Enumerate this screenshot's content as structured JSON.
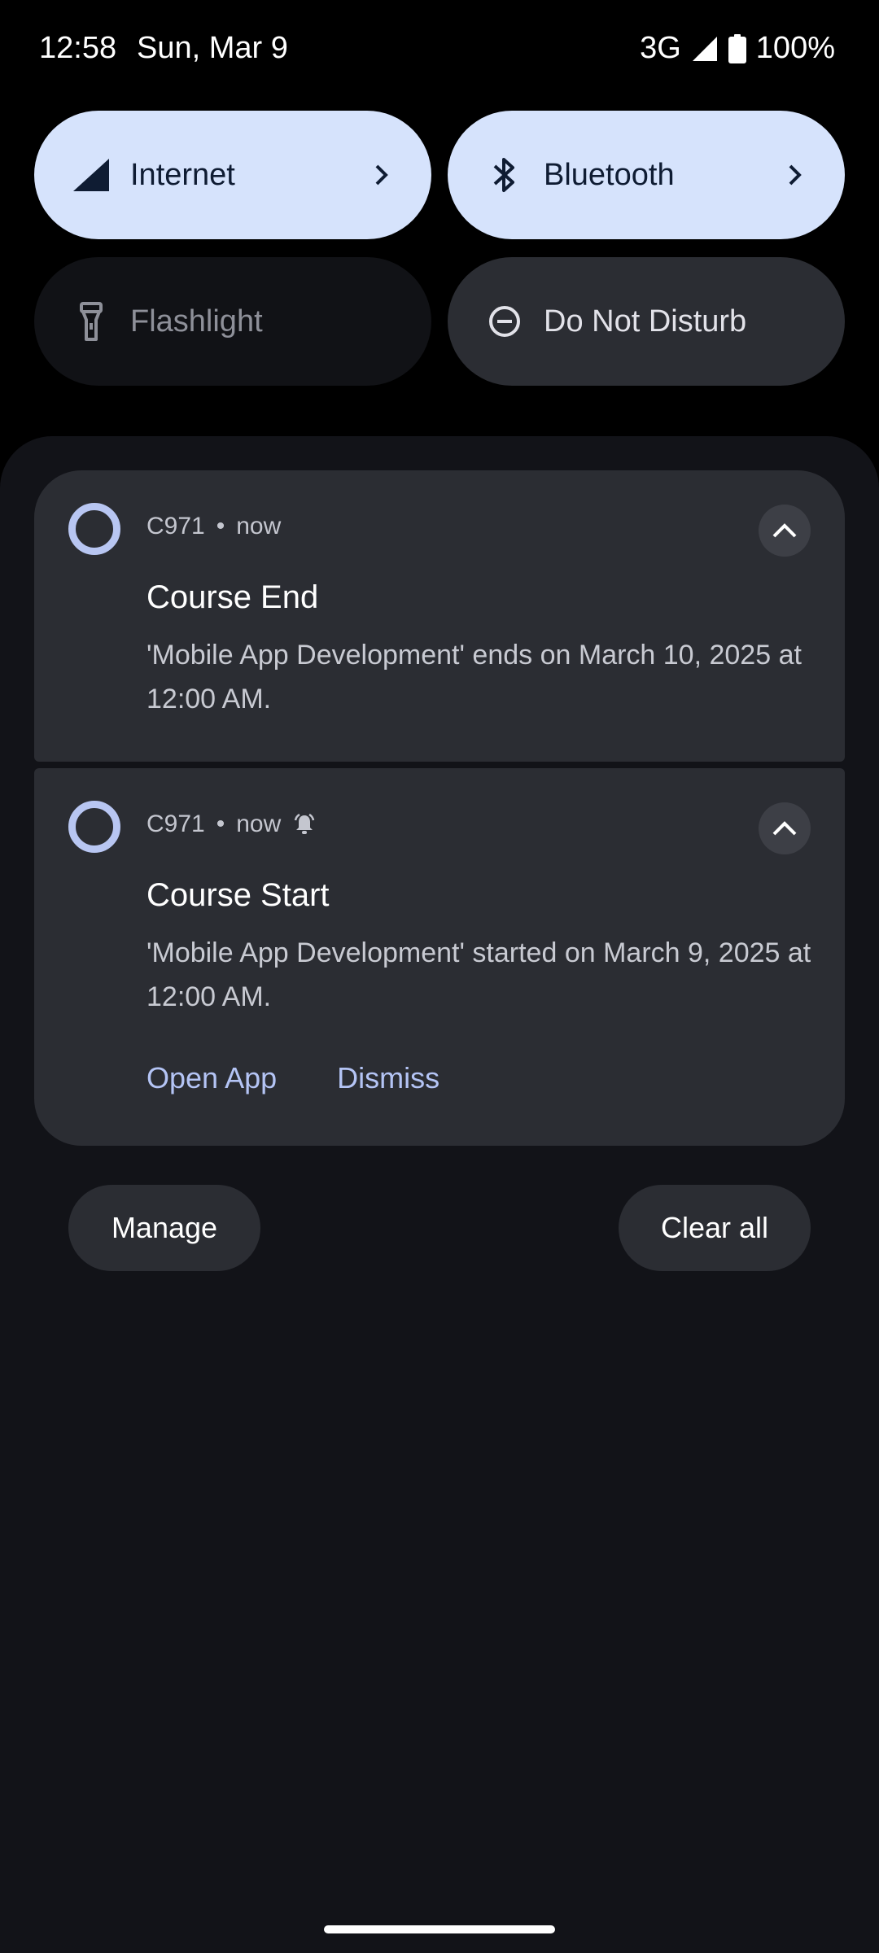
{
  "status_bar": {
    "time": "12:58",
    "date": "Sun, Mar 9",
    "network": "3G",
    "battery": "100%"
  },
  "quick_tiles": [
    {
      "label": "Internet",
      "icon": "cellular-signal-icon",
      "state": "active",
      "has_chevron": true
    },
    {
      "label": "Bluetooth",
      "icon": "bluetooth-icon",
      "state": "active",
      "has_chevron": true
    },
    {
      "label": "Flashlight",
      "icon": "flashlight-icon",
      "state": "unavailable",
      "has_chevron": false
    },
    {
      "label": "Do Not Disturb",
      "icon": "do-not-disturb-icon",
      "state": "inactive",
      "has_chevron": false
    }
  ],
  "notifications": [
    {
      "app": "C971",
      "time": "now",
      "title": "Course End",
      "body": "'Mobile App Development' ends on March 10, 2025 at 12:00 AM.",
      "alerting": false,
      "actions": []
    },
    {
      "app": "C971",
      "time": "now",
      "title": "Course Start",
      "body": "'Mobile App Development' started on March 9, 2025 at 12:00 AM.",
      "alerting": true,
      "actions": [
        "Open App",
        "Dismiss"
      ]
    }
  ],
  "footer": {
    "manage_label": "Manage",
    "clear_all_label": "Clear all"
  },
  "colors": {
    "tile_active": "#d6e3fc",
    "tile_inactive": "#2b2d33",
    "notification_card": "#2b2d33",
    "shade_background": "#121318",
    "accent_text": "#b4c4f5"
  }
}
